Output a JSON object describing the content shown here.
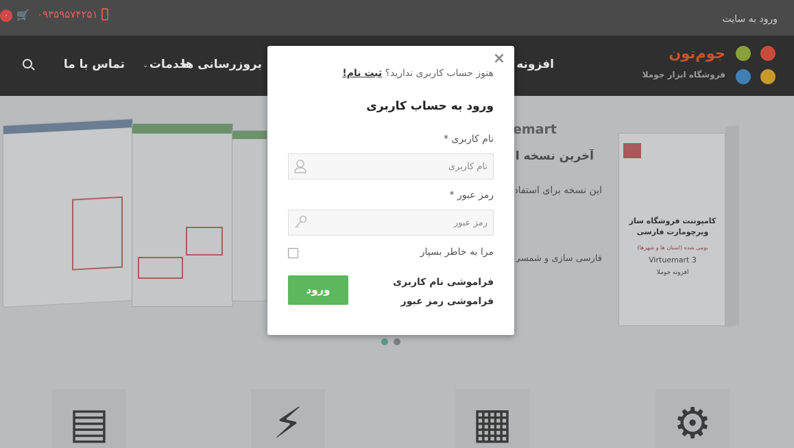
{
  "topbar": {
    "login_link": "ورود به سایت",
    "phone": "۰۹۳۵۹۵۷۴۲۵۱",
    "cart_badge": "۰"
  },
  "nav": {
    "items": [
      "افزونه ها",
      "بروزرسانی ها",
      "خدمات",
      "تماس با ما"
    ]
  },
  "logo": {
    "name": "جوم‌تون",
    "tagline": "فروشگاه ابزار جوملا"
  },
  "hero": {
    "title": "emart",
    "line1": "آخرین نسخه افزونه",
    "line2": "این نسخه برای استفاده",
    "line3": "فارسی سازی و شمسی سازی",
    "box": {
      "title": "کامپوننت فروشگاه ساز ویرچومارت فارسی",
      "subtitle": "بومی شده (استان ها و شهرها)",
      "product": "Virtuemart 3",
      "small": "افزونه جوملا"
    },
    "slider_dots": 2
  },
  "modal": {
    "close": "×",
    "register_prompt": "هنوز حساب کاربری ندارید؟",
    "register_link": "ثبت نام!",
    "title": "ورود به حساب کاربری",
    "username_label": "نام کاربری",
    "username_placeholder": "نام کاربری",
    "password_label": "رمز عبور",
    "password_placeholder": "رمز عبور",
    "required_mark": "*",
    "remember_label": "مرا به خاطر بسپار",
    "remember_checked": false,
    "submit_label": "ورود",
    "forgot_username": "فراموشی نام کاربری",
    "forgot_password": "فراموشی رمز عبور"
  },
  "colors": {
    "topbar": "#4a4a4a",
    "navbar": "#2f2f2f",
    "submit": "#5cb85c",
    "dot_active": "#5a9a8a",
    "dot_inactive": "#7a7c7d"
  }
}
